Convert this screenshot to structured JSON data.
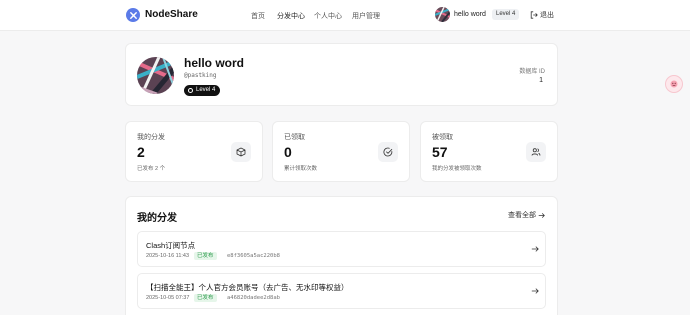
{
  "brand": "NodeShare",
  "nav": [
    "首页",
    "分发中心",
    "个人中心",
    "用户管理"
  ],
  "user": {
    "name": "hello word",
    "level": "Level 4",
    "logout": "退出"
  },
  "profile": {
    "name": "hello word",
    "handle": "@pastking",
    "level": "Level 4",
    "db_id_label": "数据库 ID",
    "db_id": "1"
  },
  "stats": [
    {
      "title": "我的分发",
      "value": "2",
      "sub": "已发布 2 个",
      "icon": "cube-icon"
    },
    {
      "title": "已领取",
      "value": "0",
      "sub": "累计领取次数",
      "icon": "check-circle-icon"
    },
    {
      "title": "被领取",
      "value": "57",
      "sub": "我的分发被领取次数",
      "icon": "users-icon"
    }
  ],
  "shares": {
    "title": "我的分发",
    "view_all": "查看全部",
    "items": [
      {
        "title": "Clash订阅节点",
        "date": "2025-10-16 11:43",
        "status": "已发布",
        "hash": "e8f3605a5ac220b8"
      },
      {
        "title": "【扫描全能王】个人官方会员账号（去广告、无水印等权益）",
        "date": "2025-10-05 07:37",
        "status": "已发布",
        "hash": "a46820dadee2d8ab"
      }
    ]
  },
  "colors": {
    "accent": "#5b7be8",
    "published_bg": "#e6f6ea",
    "published_text": "#2a9a4b"
  }
}
